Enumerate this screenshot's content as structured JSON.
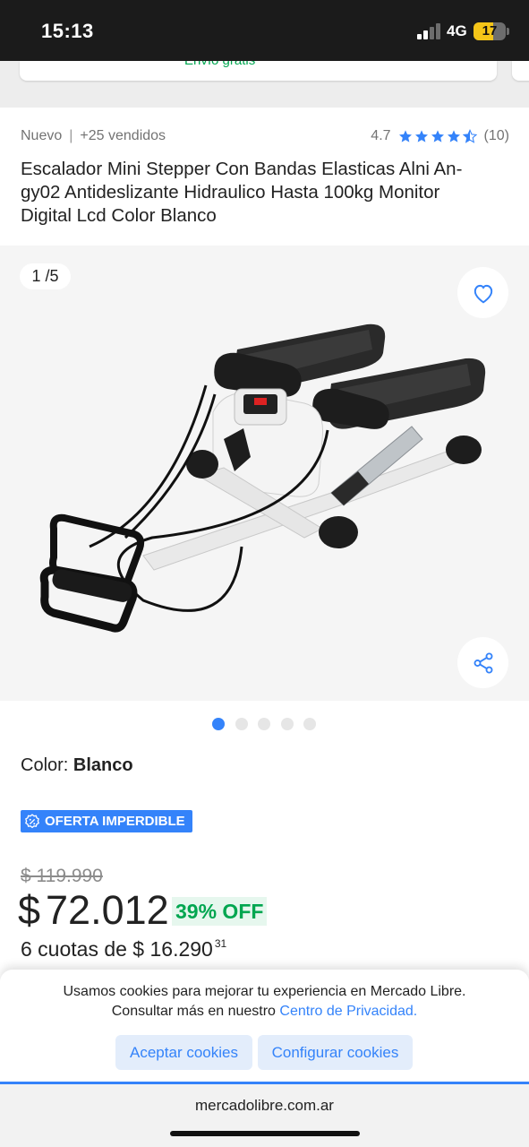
{
  "status_bar": {
    "time": "15:13",
    "network": "4G",
    "battery": "17"
  },
  "shipping_card": {
    "label": "Envío gratis"
  },
  "product": {
    "condition": "Nuevo",
    "sold": "+25 vendidos",
    "rating": "4.7",
    "reviews": "(10)",
    "title": "Escalador Mini Stepper Con Bandas Elasticas Alni An-gy02 Antideslizante Hidraulico Hasta 100kg Monitor Digital Lcd Color Blanco"
  },
  "gallery": {
    "counter": "1 /5",
    "total_images": 5,
    "active_image": 1
  },
  "variant": {
    "label": "Color: ",
    "value": "Blanco"
  },
  "badge": {
    "label": "OFERTA IMPERDIBLE"
  },
  "pricing": {
    "old_price": "$ 119.990",
    "currency": "$",
    "price": "72.012",
    "discount": "39% OFF",
    "installments": "6 cuotas de $ 16.290",
    "installments_cents": "31"
  },
  "cookie_banner": {
    "text_line1": "Usamos cookies para mejorar tu experiencia en Mercado Libre.",
    "text_line2": "Consultar más en nuestro ",
    "link": "Centro de Privacidad.",
    "accept": "Aceptar cookies",
    "configure": "Configurar cookies"
  },
  "browser": {
    "url": "mercadolibre.com.ar"
  },
  "colors": {
    "accent": "#3483fa",
    "green": "#00a650",
    "text": "#222222"
  }
}
